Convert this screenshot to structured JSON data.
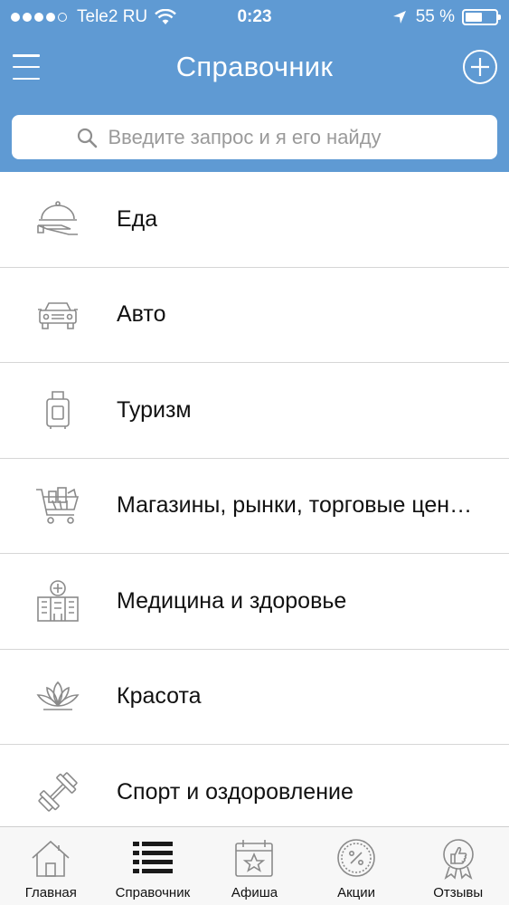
{
  "status_bar": {
    "carrier": "Tele2 RU",
    "time": "0:23",
    "battery_percent": "55 %",
    "battery_level": 0.55,
    "signal_bars_filled": 4,
    "signal_bars_total": 5
  },
  "nav": {
    "title": "Справочник",
    "menu_icon": "hamburger-icon",
    "add_icon": "plus-circle-icon"
  },
  "search": {
    "placeholder": "Введите запрос и я его найду",
    "value": ""
  },
  "categories": [
    {
      "label": "Еда",
      "icon": "food-cloche-icon"
    },
    {
      "label": "Авто",
      "icon": "car-icon"
    },
    {
      "label": "Туризм",
      "icon": "suitcase-icon"
    },
    {
      "label": "Магазины, рынки, торговые центры",
      "icon": "shopping-cart-icon"
    },
    {
      "label": "Медицина и здоровье",
      "icon": "hospital-icon"
    },
    {
      "label": "Красота",
      "icon": "lotus-icon"
    },
    {
      "label": "Спорт и оздоровление",
      "icon": "dumbbell-icon"
    }
  ],
  "tabs": [
    {
      "label": "Главная",
      "icon": "home-icon"
    },
    {
      "label": "Справочник",
      "icon": "list-icon",
      "active": true
    },
    {
      "label": "Афиша",
      "icon": "calendar-star-icon"
    },
    {
      "label": "Акции",
      "icon": "percent-badge-icon"
    },
    {
      "label": "Отзывы",
      "icon": "thumbs-up-badge-icon"
    }
  ],
  "colors": {
    "header": "#5f9ad3",
    "icon_gray": "#8a8a8a",
    "active_tab": "#1a1a1a"
  }
}
